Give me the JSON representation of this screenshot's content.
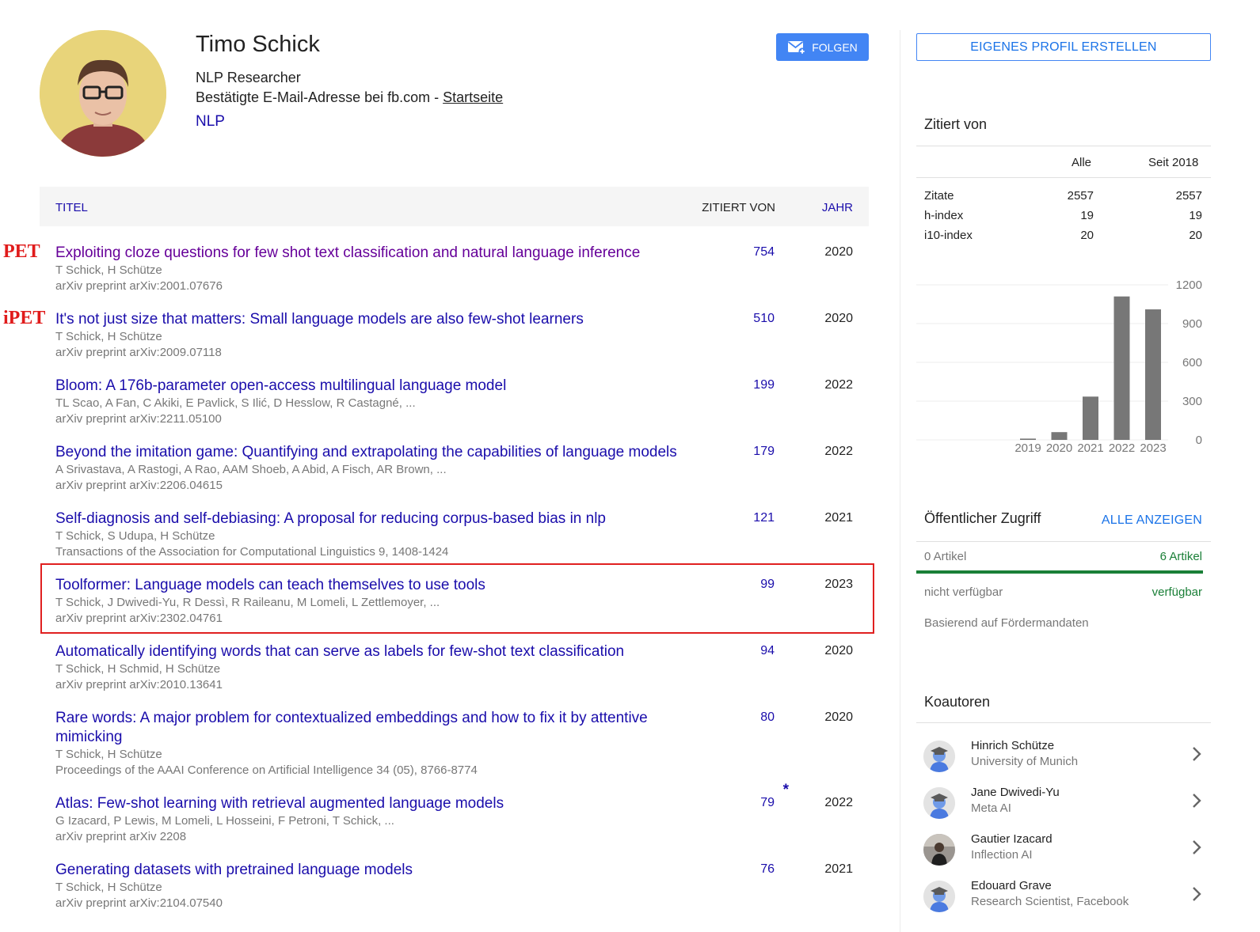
{
  "profile": {
    "name": "Timo Schick",
    "affiliation": "NLP Researcher",
    "email_text": "Bestätigte E-Mail-Adresse bei fb.com - ",
    "homepage": "Startseite",
    "interest": "NLP",
    "follow_label": "FOLGEN",
    "create_profile_label": "EIGENES PROFIL ERSTELLEN"
  },
  "table": {
    "col_title": "TITEL",
    "col_cited": "ZITIERT VON",
    "col_year": "JAHR"
  },
  "annotations": [
    "PET",
    "iPET"
  ],
  "publications": [
    {
      "title": "Exploiting cloze questions for few shot text classification and natural language inference",
      "authors": "T Schick, H Schütze",
      "venue": "arXiv preprint arXiv:2001.07676",
      "cites": "754",
      "year": "2020"
    },
    {
      "title": "It's not just size that matters: Small language models are also few-shot learners",
      "authors": "T Schick, H Schütze",
      "venue": "arXiv preprint arXiv:2009.07118",
      "cites": "510",
      "year": "2020"
    },
    {
      "title": "Bloom: A 176b-parameter open-access multilingual language model",
      "authors": "TL Scao, A Fan, C Akiki, E Pavlick, S Ilić, D Hesslow, R Castagné, ...",
      "venue": "arXiv preprint arXiv:2211.05100",
      "cites": "199",
      "year": "2022"
    },
    {
      "title": "Beyond the imitation game: Quantifying and extrapolating the capabilities of language models",
      "authors": "A Srivastava, A Rastogi, A Rao, AAM Shoeb, A Abid, A Fisch, AR Brown, ...",
      "venue": "arXiv preprint arXiv:2206.04615",
      "cites": "179",
      "year": "2022"
    },
    {
      "title": "Self-diagnosis and self-debiasing: A proposal for reducing corpus-based bias in nlp",
      "authors": "T Schick, S Udupa, H Schütze",
      "venue": "Transactions of the Association for Computational Linguistics 9, 1408-1424",
      "cites": "121",
      "year": "2021"
    },
    {
      "title": "Toolformer: Language models can teach themselves to use tools",
      "authors": "T Schick, J Dwivedi-Yu, R Dessì, R Raileanu, M Lomeli, L Zettlemoyer, ...",
      "venue": "arXiv preprint arXiv:2302.04761",
      "cites": "99",
      "year": "2023"
    },
    {
      "title": "Automatically identifying words that can serve as labels for few-shot text classification",
      "authors": "T Schick, H Schmid, H Schütze",
      "venue": "arXiv preprint arXiv:2010.13641",
      "cites": "94",
      "year": "2020"
    },
    {
      "title": "Rare words: A major problem for contextualized embeddings and how to fix it by attentive mimicking",
      "authors": "T Schick, H Schütze",
      "venue": "Proceedings of the AAAI Conference on Artificial Intelligence 34 (05), 8766-8774",
      "cites": "80",
      "year": "2020"
    },
    {
      "title": "Atlas: Few-shot learning with retrieval augmented language models",
      "authors": "G Izacard, P Lewis, M Lomeli, L Hosseini, F Petroni, T Schick, ...",
      "venue": "arXiv preprint arXiv 2208",
      "cites": "79",
      "star": "*",
      "year": "2022"
    },
    {
      "title": "Generating datasets with pretrained language models",
      "authors": "T Schick, H Schütze",
      "venue": "arXiv preprint arXiv:2104.07540",
      "cites": "76",
      "year": "2021"
    }
  ],
  "cited_by": {
    "title": "Zitiert von",
    "col_all": "Alle",
    "col_since": "Seit 2018",
    "rows": [
      {
        "label": "Zitate",
        "all": "2557",
        "since": "2557"
      },
      {
        "label": "h-index",
        "all": "19",
        "since": "19"
      },
      {
        "label": "i10-index",
        "all": "20",
        "since": "20"
      }
    ]
  },
  "chart_data": {
    "type": "bar",
    "categories": [
      "2019",
      "2020",
      "2021",
      "2022",
      "2023"
    ],
    "values": [
      10,
      60,
      335,
      1110,
      1010
    ],
    "ylim": [
      0,
      1200
    ],
    "yticks": [
      0,
      300,
      600,
      900,
      1200
    ],
    "color": "#777777"
  },
  "public_access": {
    "title": "Öffentlicher Zugriff",
    "show_all": "ALLE ANZEIGEN",
    "left_count": "0 Artikel",
    "right_count": "6 Artikel",
    "left_label": "nicht verfügbar",
    "right_label": "verfügbar",
    "note": "Basierend auf Fördermandaten",
    "available_fraction": 1.0
  },
  "coauthors": {
    "title": "Koautoren",
    "items": [
      {
        "name": "Hinrich Schütze",
        "affiliation": "University of Munich",
        "avatar": "scholar-placeholder-icon"
      },
      {
        "name": "Jane Dwivedi-Yu",
        "affiliation": "Meta AI",
        "avatar": "scholar-placeholder-icon"
      },
      {
        "name": "Gautier Izacard",
        "affiliation": "Inflection AI",
        "avatar": "photo"
      },
      {
        "name": "Edouard Grave",
        "affiliation": "Research Scientist, Facebook",
        "avatar": "scholar-placeholder-icon"
      }
    ]
  }
}
